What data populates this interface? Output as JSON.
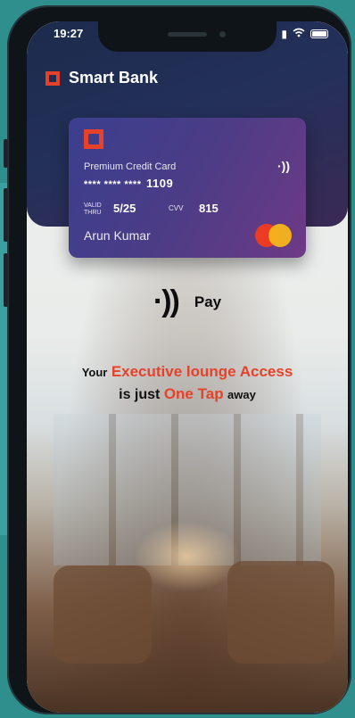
{
  "status_bar": {
    "time": "19:27"
  },
  "brand": {
    "name": "Smart Bank"
  },
  "card": {
    "type_label": "Premium Credit Card",
    "number_masked": "**** **** ****",
    "number_last4": "1109",
    "valid_label": "VALID THRU",
    "valid_value": "5/25",
    "cvv_label": "CVV",
    "cvv_value": "815",
    "holder_name": "Arun Kumar",
    "contactless_icon": "nfc-icon",
    "network_logo": "mastercard-logo"
  },
  "pay": {
    "label": "Pay",
    "icon": "contactless-pay-icon"
  },
  "promo": {
    "line1_prefix": "Your",
    "line1_highlight": "Executive lounge Access",
    "line2_prefix": "is just",
    "line2_highlight": "One Tap",
    "line2_suffix": "away"
  },
  "colors": {
    "accent_red": "#e8412a",
    "header_navy": "#1c2b4c",
    "card_start": "#3a3f8e",
    "card_end": "#6e3a86",
    "mastercard_red": "#eb3b23",
    "mastercard_yellow": "#f7b51b"
  }
}
